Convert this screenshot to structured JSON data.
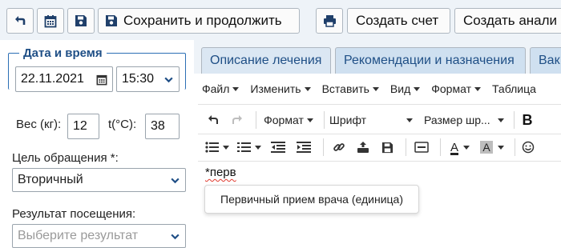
{
  "toolbar": {
    "save_continue_label": "Сохранить и продолжить",
    "create_invoice_label": "Создать счет",
    "create_analysis_label": "Создать анали"
  },
  "datetime": {
    "legend": "Дата и время",
    "date": "22.11.2021",
    "time": "15:30"
  },
  "vitals": {
    "weight_label": "Вес (кг):",
    "weight_value": "12",
    "temp_label": "t(°C):",
    "temp_value": "38"
  },
  "purpose": {
    "label": "Цель обращения *:",
    "value": "Вторичный"
  },
  "result": {
    "label": "Результат посещения:",
    "placeholder": "Выберите результат"
  },
  "tabs": [
    {
      "label": "Описание лечения"
    },
    {
      "label": "Рекомендации и назначения"
    },
    {
      "label": "Вак"
    }
  ],
  "menu": [
    {
      "label": "Файл"
    },
    {
      "label": "Изменить"
    },
    {
      "label": "Вставить"
    },
    {
      "label": "Вид"
    },
    {
      "label": "Формат"
    },
    {
      "label": "Таблица"
    }
  ],
  "format_toolbar": {
    "format_label": "Формат",
    "font_label": "Шрифт",
    "size_label": "Размер шр..."
  },
  "editor": {
    "typed_text": "*перв",
    "suggestion": "Первичный прием врача (единица)"
  },
  "colors": {
    "accent": "#1f4f86",
    "border": "#aeb7c0",
    "header_bg": "#eef3f8"
  }
}
